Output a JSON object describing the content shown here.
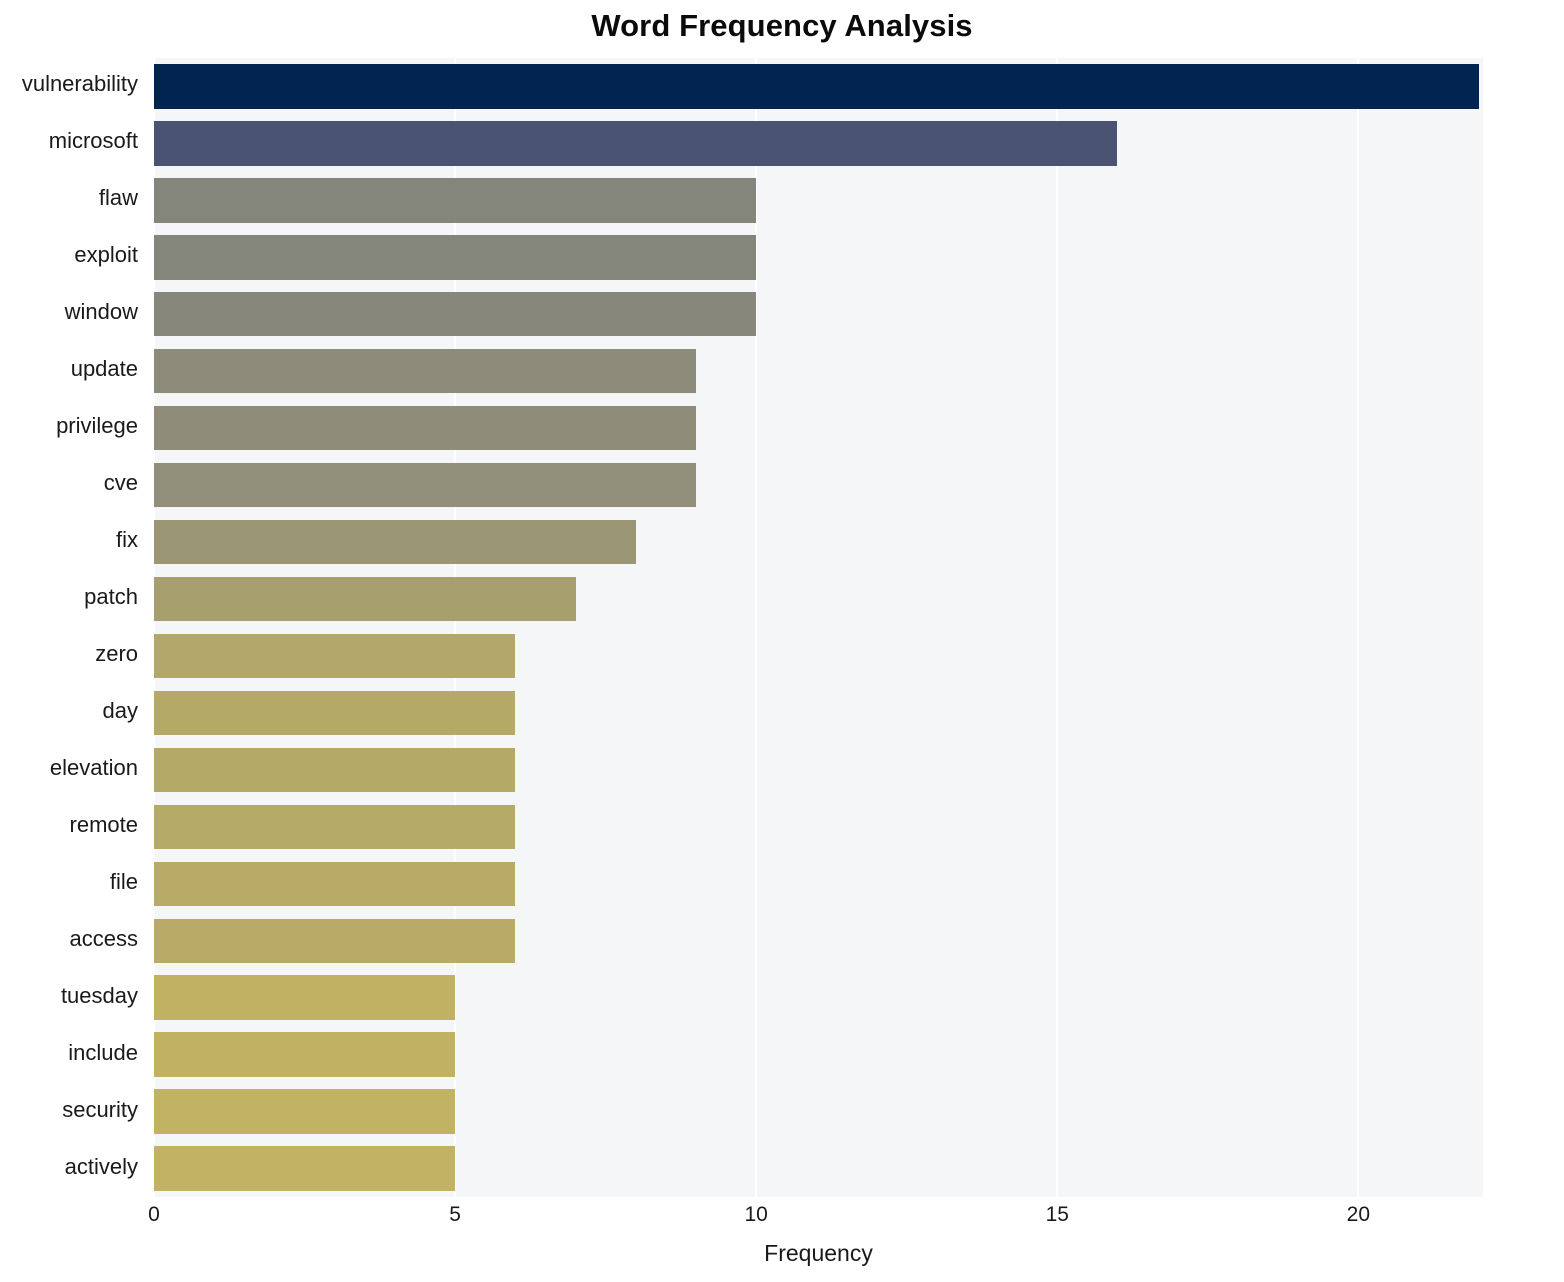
{
  "chart_data": {
    "type": "bar",
    "orientation": "horizontal",
    "title": "Word Frequency Analysis",
    "xlabel": "Frequency",
    "ylabel": "",
    "xlim": [
      0,
      22.07
    ],
    "xticks": [
      0,
      5,
      10,
      15,
      20
    ],
    "xtick_labels": [
      "0",
      "5",
      "10",
      "15",
      "20"
    ],
    "grid": "vertical-white-on-light-gray",
    "legend": "none",
    "categories": [
      "vulnerability",
      "microsoft",
      "flaw",
      "exploit",
      "window",
      "update",
      "privilege",
      "cve",
      "fix",
      "patch",
      "zero",
      "day",
      "elevation",
      "remote",
      "file",
      "access",
      "tuesday",
      "include",
      "security",
      "actively"
    ],
    "values": [
      22,
      16,
      10,
      10,
      10,
      9,
      9,
      9,
      8,
      7,
      6,
      6,
      6,
      6,
      6,
      6,
      5,
      5,
      5,
      5
    ],
    "bar_colors": [
      "#012451",
      "#4a5372",
      "#85867b",
      "#85867b",
      "#87877c",
      "#8d8c7a",
      "#8f8d79",
      "#918f7a",
      "#9b9673",
      "#a79f6e",
      "#b3a869",
      "#b5a968",
      "#b5a968",
      "#b6aa68",
      "#b7ab67",
      "#b8ab67",
      "#c0b163",
      "#c1b263",
      "#c2b263",
      "#c2b263"
    ],
    "plot_background": "#f5f6f7",
    "figure_background": "#ffffff",
    "text_color": "#1a1a1a"
  }
}
